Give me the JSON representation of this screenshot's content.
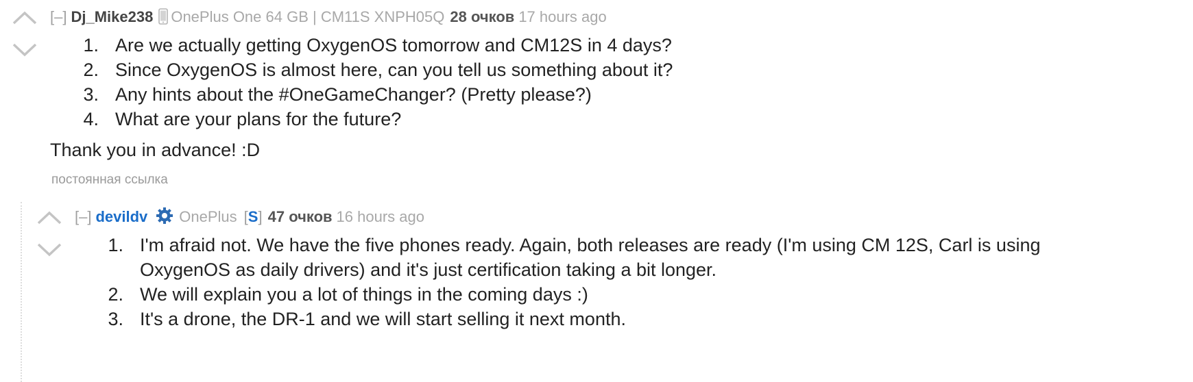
{
  "comments": [
    {
      "collapse": "[–]",
      "author": "Dj_Mike238",
      "flair": "OnePlus One 64 GB | CM11S XNPH05Q",
      "score": "28 очков",
      "time": "17 hours ago",
      "list": [
        "Are we actually getting OxygenOS tomorrow and CM12S in 4 days?",
        "Since OxygenOS is almost here, can you tell us something about it?",
        "Any hints about the #OneGameChanger? (Pretty please?)",
        "What are your plans for the future?"
      ],
      "paragraph": "Thank you in advance! :D",
      "permalink": "постоянная ссылка",
      "icons": [
        "upvote-arrow-icon",
        "downvote-arrow-icon",
        "phone-icon"
      ]
    },
    {
      "collapse": "[–]",
      "author": "devildv",
      "flair": "OnePlus",
      "badge_open": "[",
      "badge": "S",
      "badge_close": "]",
      "score": "47 очков",
      "time": "16 hours ago",
      "list": [
        "I'm afraid not. We have the five phones ready. Again, both releases are ready (I'm using CM 12S, Carl is using OxygenOS as daily drivers) and it's just certification taking a bit longer.",
        "We will explain you a lot of things in the coming days :)",
        "It's a drone, the DR-1 and we will start selling it next month."
      ],
      "icons": [
        "upvote-arrow-icon",
        "downvote-arrow-icon",
        "gear-icon"
      ]
    }
  ],
  "colors": {
    "author_link": "#1a6dc9",
    "muted": "#a8a8a8",
    "text": "#222222"
  }
}
